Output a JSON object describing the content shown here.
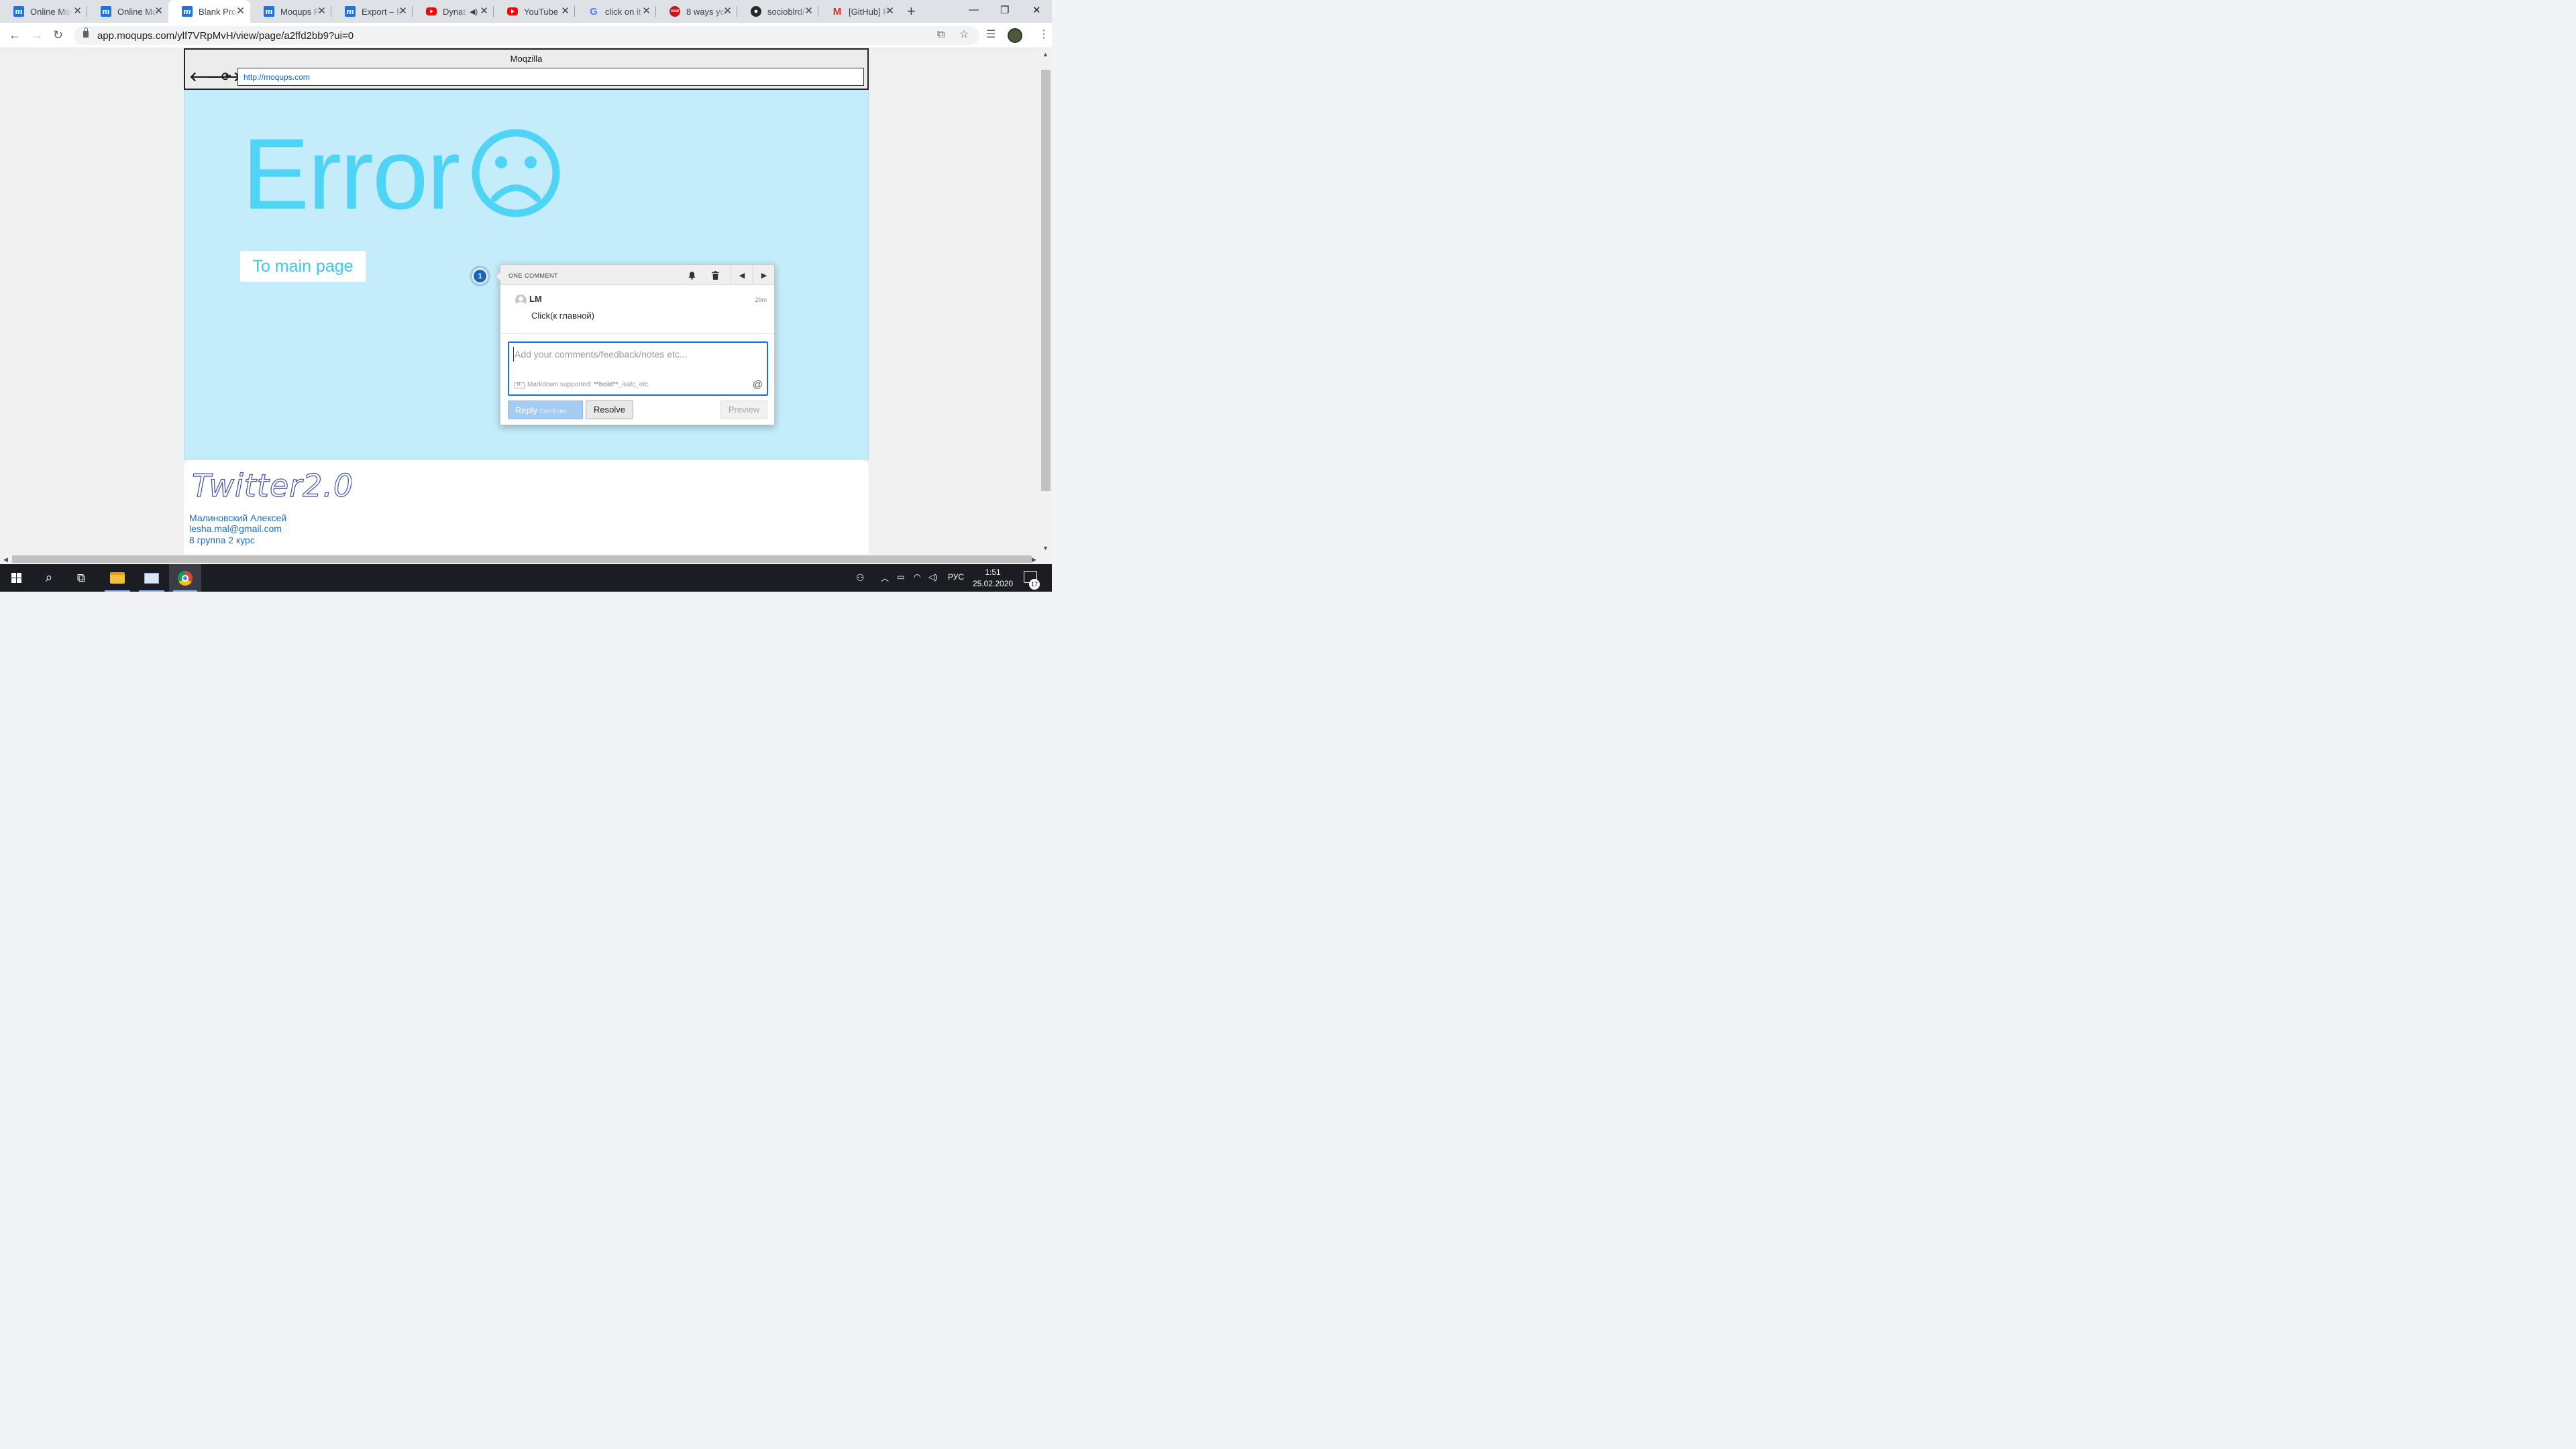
{
  "browser": {
    "tabs": [
      {
        "title": "Online Mockup",
        "favicon": "moqups-icon",
        "active": false
      },
      {
        "title": "Online Mockup",
        "favicon": "moqups-icon",
        "active": false
      },
      {
        "title": "Blank Project",
        "favicon": "moqups-icon",
        "active": true
      },
      {
        "title": "Moqups Pricing",
        "favicon": "moqups-icon",
        "active": false
      },
      {
        "title": "Export – Moqups",
        "favicon": "moqups-icon",
        "active": false
      },
      {
        "title": "Dynatrace",
        "favicon": "youtube-icon",
        "active": false,
        "audio": true
      },
      {
        "title": "YouTube",
        "favicon": "youtube-icon",
        "active": false
      },
      {
        "title": "click on it",
        "favicon": "google-icon",
        "active": false
      },
      {
        "title": "8 ways you",
        "favicon": "cnet-icon",
        "active": false
      },
      {
        "title": "socioblrd/",
        "favicon": "github-icon",
        "active": false
      },
      {
        "title": "[GitHub] P",
        "favicon": "gmail-icon",
        "active": false
      }
    ],
    "url": "app.moqups.com/ylf7VRpMvH/view/page/a2ffd2bb9?ui=0"
  },
  "mockup": {
    "window_title": "Moqzilla",
    "address": "http://moqups.com",
    "error_heading": "Error",
    "main_button": "To main page",
    "logo_text": "Twitter2.0",
    "footer": {
      "name": "Малиновский Алексей",
      "email": "lesha.mal@gmail.com",
      "group": "8 группа 2 курс"
    }
  },
  "comment": {
    "marker_number": "1",
    "header_label": "ONE COMMENT",
    "author": "LM",
    "time": "29m",
    "text": "Click(к главной)",
    "input_placeholder": "Add your comments/feedback/notes etc...",
    "markdown_badge": "M↓",
    "markdown_note": "Markdown supported:",
    "markdown_bold": "**bold**",
    "markdown_italic": "_italic_",
    "markdown_etc": "etc.",
    "at_symbol": "@",
    "reply_label": "Reply",
    "reply_shortcut": "Ctrl+Enter",
    "resolve_label": "Resolve",
    "preview_label": "Preview"
  },
  "taskbar": {
    "language": "РУС",
    "time": "1:51",
    "date": "25.02.2020",
    "notification_count": "17"
  },
  "colors": {
    "error_cyan": "#4fd4f6",
    "mock_bg": "#c4ecfa",
    "link_blue": "#1c6fc4"
  }
}
